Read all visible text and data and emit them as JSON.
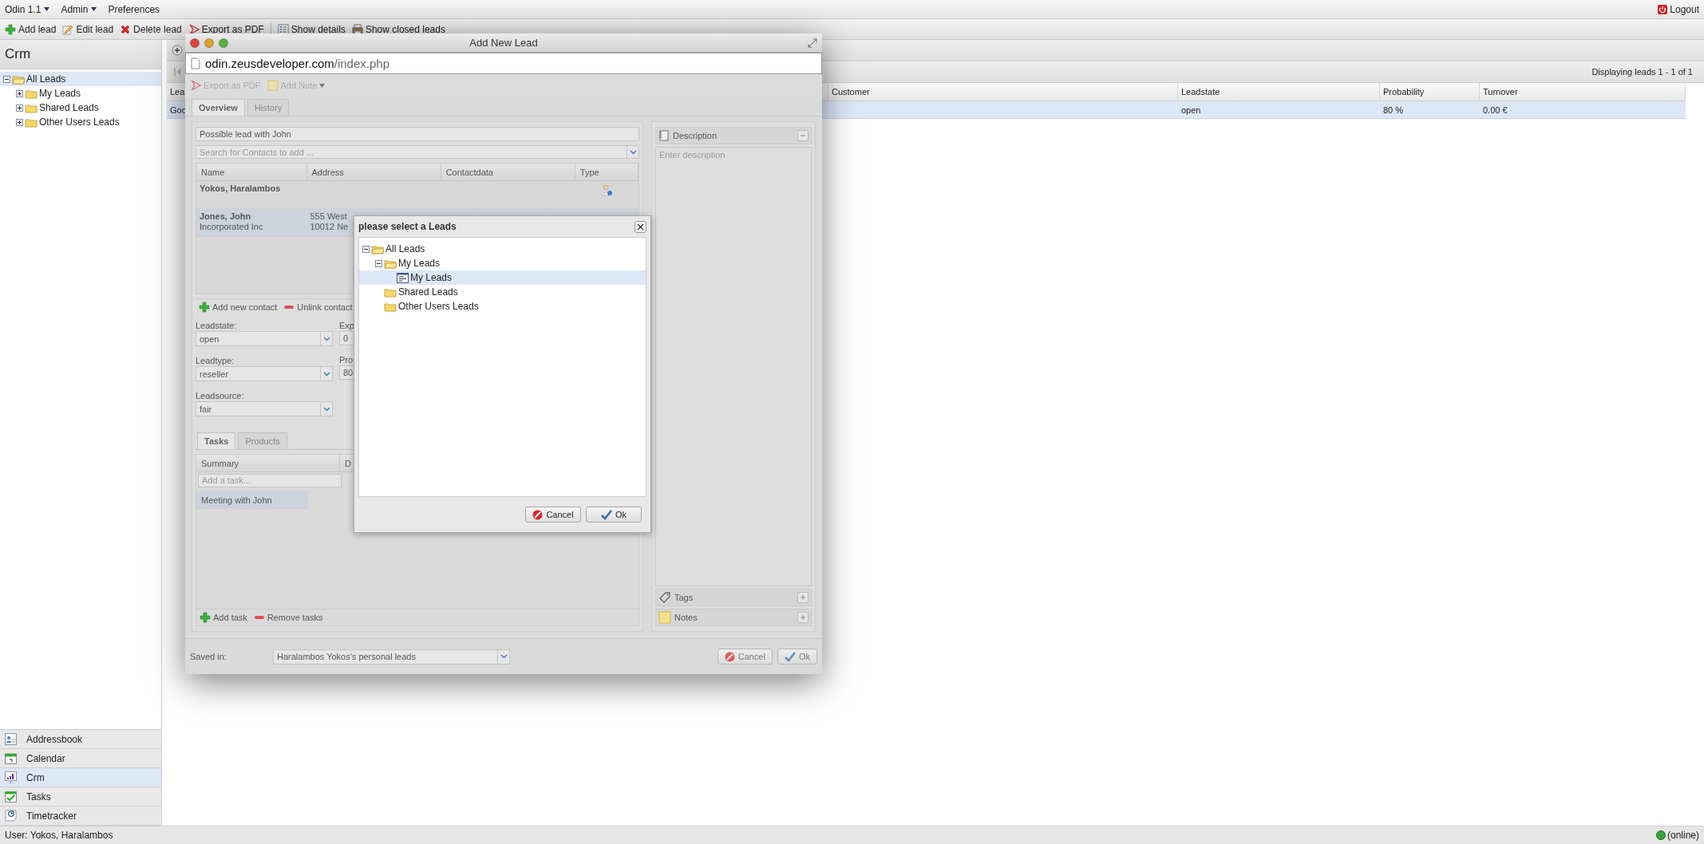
{
  "menu_bar": {
    "menus": [
      {
        "label": "Odin 1.1",
        "dropdown": true
      },
      {
        "label": "Admin",
        "dropdown": true
      },
      {
        "label": "Preferences",
        "dropdown": false
      }
    ],
    "logout": "Logout"
  },
  "toolbar": [
    {
      "label": "Add lead",
      "kind": "add",
      "separator_before": false
    },
    {
      "label": "Edit lead",
      "kind": "edit",
      "separator_before": false
    },
    {
      "label": "Delete lead",
      "kind": "delete",
      "separator_before": false
    },
    {
      "label": "Export as PDF",
      "kind": "pdf",
      "separator_before": false
    },
    {
      "label": "Show details",
      "kind": "details",
      "separator_before": true
    },
    {
      "label": "Show closed leads",
      "kind": "closed",
      "separator_before": false
    }
  ],
  "sidebar": {
    "title": "Crm",
    "tree": [
      {
        "label": "All Leads",
        "kind": "folder",
        "expanded": true,
        "selected": true,
        "children": [
          {
            "label": "My Leads",
            "kind": "folder",
            "expanded": false,
            "selected": false
          },
          {
            "label": "Shared Leads",
            "kind": "folder",
            "expanded": false,
            "selected": false
          },
          {
            "label": "Other Users Leads",
            "kind": "folder",
            "expanded": false,
            "selected": false
          }
        ]
      }
    ],
    "nav": [
      {
        "label": "Addressbook",
        "kind": "addressbook",
        "selected": false
      },
      {
        "label": "Calendar",
        "kind": "calendar",
        "selected": false
      },
      {
        "label": "Crm",
        "kind": "crm",
        "selected": true
      },
      {
        "label": "Tasks",
        "kind": "tasks",
        "selected": false
      },
      {
        "label": "Timetracker",
        "kind": "timetracker",
        "selected": false
      }
    ]
  },
  "main": {
    "paging_info": "Displaying leads 1 - 1 of 1",
    "grid": {
      "columns": [
        "Lea",
        "Customer",
        "Leadstate",
        "Probability",
        "Turnover"
      ],
      "rows": [
        {
          "lead": "Goo",
          "leadstate": "open",
          "probability": "80 %",
          "turnover": "0.00 €",
          "selected": true
        }
      ]
    }
  },
  "lead_window": {
    "title": "Add New Lead",
    "url_host": "odin.zeusdeveloper.com",
    "url_path": "/index.php",
    "toolbar": [
      {
        "label": "Export as PDF",
        "kind": "pdf",
        "dropdown": false
      },
      {
        "label": "Add Note",
        "kind": "note",
        "dropdown": true
      }
    ],
    "tabs": [
      {
        "label": "Overview",
        "selected": true
      },
      {
        "label": "History",
        "selected": false
      }
    ],
    "subject": "Possible lead with John",
    "contact_search": {
      "placeholder": "Search for Contacts to add ..."
    },
    "contacts": {
      "columns": [
        "Name",
        "Address",
        "Contactdata",
        "Type"
      ],
      "rows": [
        {
          "name": "Yokos, Haralambos",
          "kind": "person",
          "selected": false
        },
        {
          "name": "Jones, John",
          "company": "Incorporated Inc",
          "address": [
            "555 West",
            "10012 Ne"
          ],
          "selected": true
        }
      ]
    },
    "contact_actions": [
      {
        "label": "Add new contact",
        "kind": "add"
      },
      {
        "label": "Unlink contact",
        "kind": "remove"
      }
    ],
    "fields": [
      {
        "label": "Leadstate:",
        "value": "open"
      },
      {
        "label": "Leadtype:",
        "value": "reseller"
      },
      {
        "label": "Leadsource:",
        "value": "fair"
      }
    ],
    "fields_2": [
      {
        "label": "Exp",
        "value": "0"
      },
      {
        "label": "Pro",
        "value": "80"
      }
    ],
    "task_tabs": [
      {
        "label": "Tasks",
        "selected": true
      },
      {
        "label": "Products",
        "selected": false
      }
    ],
    "tasks": {
      "columns": [
        "Summary",
        "D"
      ],
      "new_task": {
        "placeholder": "Add a task..."
      },
      "rows": [
        {
          "summary": "Meeting with John",
          "selected": true
        }
      ]
    },
    "task_actions": [
      {
        "label": "Add task",
        "kind": "add"
      },
      {
        "label": "Remove tasks",
        "kind": "remove"
      }
    ],
    "description": {
      "title": "Description",
      "placeholder": "Enter description"
    },
    "sections": [
      {
        "title": "Tags",
        "kind": "tags"
      },
      {
        "title": "Notes",
        "kind": "notes"
      }
    ],
    "saved_in": {
      "label": "Saved in:",
      "value": "Haralambos Yokos's personal leads"
    },
    "buttons": [
      {
        "label": "Cancel",
        "kind": "cancel"
      },
      {
        "label": "Ok",
        "kind": "ok"
      }
    ]
  },
  "select_dialog": {
    "title": "please select a Leads",
    "tree": [
      {
        "label": "All Leads",
        "kind": "folder",
        "expanded": true,
        "selected": false,
        "children": [
          {
            "label": "My Leads",
            "kind": "folder",
            "expanded": true,
            "selected": false,
            "children": [
              {
                "label": "My Leads",
                "kind": "container",
                "selected": true
              }
            ]
          },
          {
            "label": "Shared Leads",
            "kind": "folder",
            "selected": false
          },
          {
            "label": "Other Users Leads",
            "kind": "folder",
            "selected": false
          }
        ]
      }
    ],
    "buttons": [
      {
        "label": "Cancel",
        "kind": "cancel"
      },
      {
        "label": "Ok",
        "kind": "ok"
      }
    ]
  },
  "status_bar": {
    "user": "User: Yokos, Haralambos",
    "connection": "(online)",
    "online": true
  }
}
